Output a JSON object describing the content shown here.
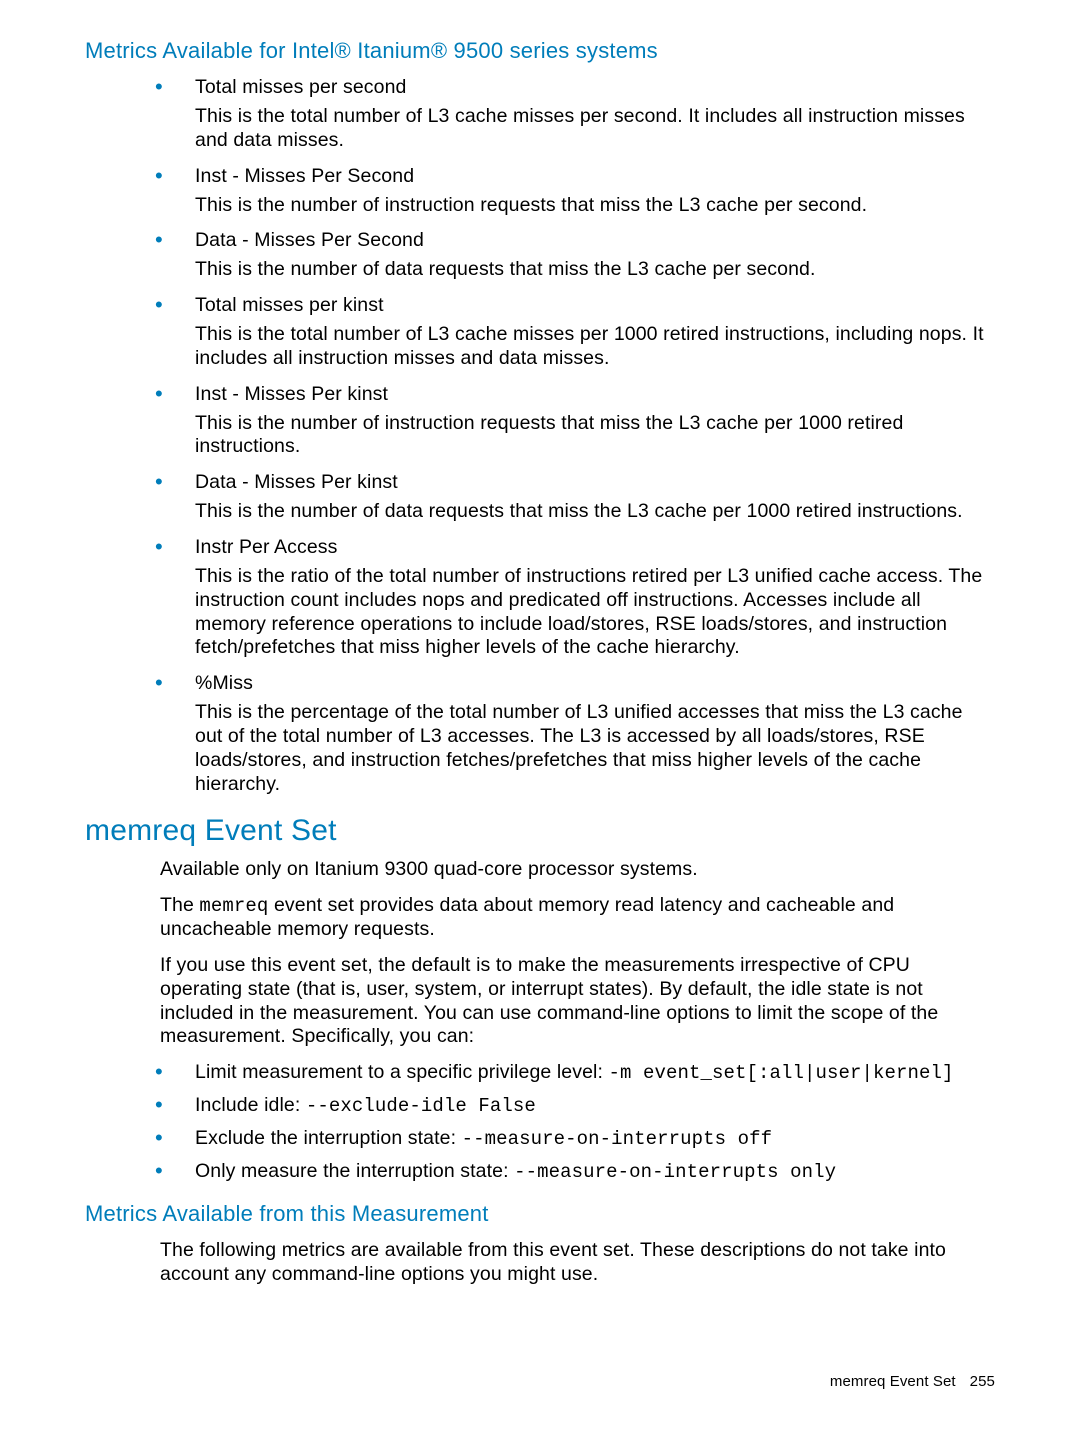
{
  "section1": {
    "heading": "Metrics Available for Intel® Itanium® 9500 series systems",
    "items": [
      {
        "title": "Total misses per second",
        "body": "This is the total number of L3 cache misses per second. It includes all instruction misses and data misses."
      },
      {
        "title": "Inst - Misses Per Second",
        "body": "This is the number of instruction requests that miss the L3 cache per second."
      },
      {
        "title": "Data - Misses Per Second",
        "body": "This is the number of data requests that miss the L3 cache per second."
      },
      {
        "title": "Total misses per kinst",
        "body": "This is the total number of L3 cache misses per 1000 retired instructions, including nops. It includes all instruction misses and data misses."
      },
      {
        "title": "Inst - Misses Per kinst",
        "body": "This is the number of instruction requests that miss the L3 cache per 1000 retired instructions."
      },
      {
        "title": "Data - Misses Per kinst",
        "body": "This is the number of data requests that miss the L3 cache per 1000 retired instructions."
      },
      {
        "title": "Instr Per Access",
        "body": "This is the ratio of the total number of instructions retired per L3 unified cache access. The instruction count includes nops and predicated off instructions. Accesses include all memory reference operations to include load/stores, RSE loads/stores, and instruction fetch/prefetches that miss higher levels of the cache hierarchy."
      },
      {
        "title": "%Miss",
        "body": "This is the percentage of the total number of L3 unified accesses that miss the L3 cache out of the total number of L3 accesses. The L3 is accessed by all loads/stores, RSE loads/stores, and instruction fetches/prefetches that miss higher levels of the cache hierarchy."
      }
    ]
  },
  "section2": {
    "heading": "memreq Event Set",
    "p1": "Available only on Itanium 9300 quad-core processor systems.",
    "p2_pre": "The ",
    "p2_code": "memreq",
    "p2_post": " event set provides data about memory read latency and cacheable and uncacheable memory requests.",
    "p3": "If you use this event set, the default is to make the measurements irrespective of CPU operating state (that is, user, system, or interrupt states). By default, the idle state is not included in the measurement. You can use command-line options to limit the scope of the measurement. Specifically, you can:",
    "opts": [
      {
        "label": "Limit measurement to a specific privilege level: ",
        "code": "-m event_set[:all|user|kernel]"
      },
      {
        "label": "Include idle: ",
        "code": "--exclude-idle False"
      },
      {
        "label": "Exclude the interruption state: ",
        "code": "--measure-on-interrupts off"
      },
      {
        "label": "Only measure the interruption state: ",
        "code": "--measure-on-interrupts only"
      }
    ]
  },
  "section3": {
    "heading": "Metrics Available from this Measurement",
    "p1": "The following metrics are available from this event set. These descriptions do not take into account any command-line options you might use."
  },
  "footer": {
    "section": "memreq Event Set",
    "page": "255"
  }
}
